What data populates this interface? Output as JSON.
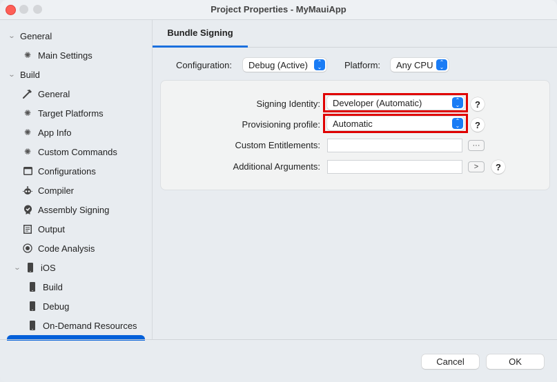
{
  "window": {
    "title": "Project Properties - MyMauiApp"
  },
  "sidebar": {
    "items": [
      {
        "label": "General",
        "icon": "chevron-down-icon",
        "level": 0
      },
      {
        "label": "Main Settings",
        "icon": "gear-icon",
        "level": 1
      },
      {
        "label": "Build",
        "icon": "chevron-down-icon",
        "level": 0
      },
      {
        "label": "General",
        "icon": "hammer-icon",
        "level": 1
      },
      {
        "label": "Target Platforms",
        "icon": "gear-icon",
        "level": 1
      },
      {
        "label": "App Info",
        "icon": "gear-icon",
        "level": 1
      },
      {
        "label": "Custom Commands",
        "icon": "gear-icon",
        "level": 1
      },
      {
        "label": "Configurations",
        "icon": "window-icon",
        "level": 1
      },
      {
        "label": "Compiler",
        "icon": "robot-icon",
        "level": 1
      },
      {
        "label": "Assembly Signing",
        "icon": "badge-check-icon",
        "level": 1
      },
      {
        "label": "Output",
        "icon": "document-icon",
        "level": 1
      },
      {
        "label": "Code Analysis",
        "icon": "radio-icon",
        "level": 1
      },
      {
        "label": "iOS",
        "icon": "phone-icon",
        "level": 1
      },
      {
        "label": "Build",
        "icon": "phone-icon",
        "level": 2
      },
      {
        "label": "Debug",
        "icon": "phone-icon",
        "level": 2
      },
      {
        "label": "On-Demand Resources",
        "icon": "phone-icon",
        "level": 2
      }
    ],
    "selected_color": "#0460d9"
  },
  "main": {
    "tab": "Bundle Signing",
    "configuration_label": "Configuration:",
    "configuration_value": "Debug (Active)",
    "platform_label": "Platform:",
    "platform_value": "Any CPU",
    "signing_identity_label": "Signing Identity:",
    "signing_identity_value": "Developer (Automatic)",
    "provisioning_profile_label": "Provisioning profile:",
    "provisioning_profile_value": "Automatic",
    "custom_entitlements_label": "Custom Entitlements:",
    "custom_entitlements_value": "",
    "additional_arguments_label": "Additional Arguments:",
    "additional_arguments_value": "",
    "help_glyph": "?",
    "browse_glyph": "···",
    "arrow_glyph": ">",
    "highlight_color": "#e00000"
  },
  "footer": {
    "cancel": "Cancel",
    "ok": "OK"
  }
}
